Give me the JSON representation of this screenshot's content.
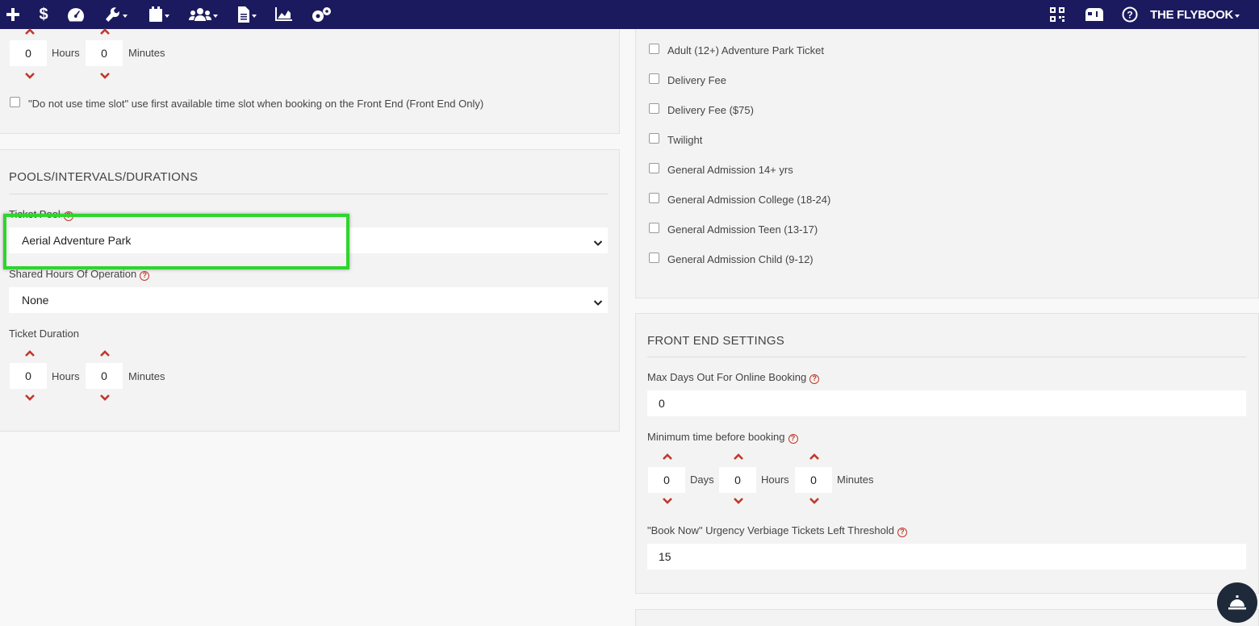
{
  "navbar": {
    "brand": "THE FLYBOOK",
    "icons": [
      "plus-icon",
      "dollar-icon",
      "dashboard-icon",
      "wrench-icon",
      "calendar-icon",
      "users-icon",
      "document-icon",
      "chart-icon",
      "settings-icon"
    ],
    "right_icons": [
      "qr-code-icon",
      "mailbox-icon",
      "help-icon"
    ],
    "colors": {
      "bg": "#1c1a5e",
      "accent": "#c0392b",
      "highlight": "#2ed52e"
    }
  },
  "top_panel": {
    "hours_value": "0",
    "hours_unit": "Hours",
    "minutes_value": "0",
    "minutes_unit": "Minutes",
    "time_slot_checkbox_label": "\"Do not use time slot\" use first available time slot when booking on the Front End (Front End Only)"
  },
  "pools": {
    "title": "POOLS/INTERVALS/DURATIONS",
    "ticket_pool_label": "Ticket Pool",
    "ticket_pool_value": "Aerial Adventure Park",
    "shared_hours_label": "Shared Hours Of Operation",
    "shared_hours_value": "None",
    "ticket_duration_label": "Ticket Duration",
    "duration_hours_value": "0",
    "duration_hours_unit": "Hours",
    "duration_minutes_value": "0",
    "duration_minutes_unit": "Minutes"
  },
  "tickets": {
    "items": [
      "Adult (12+) Adventure Park Ticket",
      "Delivery Fee",
      "Delivery Fee ($75)",
      "Twilight",
      "General Admission 14+ yrs",
      "General Admission College (18-24)",
      "General Admission Teen (13-17)",
      "General Admission Child (9-12)"
    ]
  },
  "front_end": {
    "title": "FRONT END SETTINGS",
    "max_days_label": "Max Days Out For Online Booking",
    "max_days_value": "0",
    "min_time_label": "Minimum time before booking",
    "days_value": "0",
    "days_unit": "Days",
    "hours_value": "0",
    "hours_unit": "Hours",
    "minutes_value": "0",
    "minutes_unit": "Minutes",
    "urgency_label": "\"Book Now\" Urgency Verbiage Tickets Left Threshold",
    "urgency_value": "15"
  }
}
